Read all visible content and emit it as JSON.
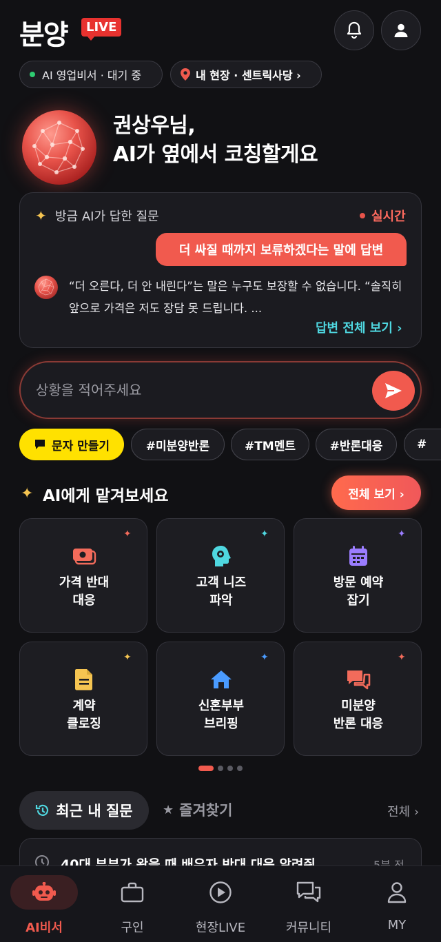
{
  "header": {
    "logo": "분양",
    "live_badge": "LIVE",
    "bell_icon": "bell-icon",
    "user_icon": "user-icon"
  },
  "status": {
    "ai_status": "AI 영업비서 · 대기 중",
    "site": "내 현장 · 센트릭사당 ›"
  },
  "hero": {
    "line1": "권상우님,",
    "line2": "AI가 옆에서 코칭할게요"
  },
  "qa_card": {
    "heading": "방금 AI가 답한 질문",
    "live_label": "실시간",
    "question": "더 싸질 때까지 보류하겠다는 말에 답변",
    "answer": "“더 오른다, 더 안 내린다”는 말은 누구도 보장할 수 없습니다. “솔직히 앞으로 가격은 저도 장담 못 드립니다. ...",
    "view_all": "답변 전체 보기 ›"
  },
  "composer": {
    "placeholder": "상황을 적어주세요",
    "send_icon": "send-icon"
  },
  "chips": [
    {
      "label": "문자 만들기"
    },
    {
      "label": "#미분양반론"
    },
    {
      "label": "#TM멘트"
    },
    {
      "label": "#반론대응"
    },
    {
      "label": "#"
    }
  ],
  "ai_section": {
    "title": "AI에게 맡겨보세요",
    "all_button": "전체 보기 ›",
    "tiles": [
      {
        "label": "가격 반대\n대응",
        "icon": "money-icon",
        "color": "#f26b5b"
      },
      {
        "label": "고객 니즈\n파악",
        "icon": "brain-gear-icon",
        "color": "#4fd7e0"
      },
      {
        "label": "방문 예약\n잡기",
        "icon": "calendar-icon",
        "color": "#9b7dff"
      },
      {
        "label": "계약\n클로징",
        "icon": "document-icon",
        "color": "#f5c451"
      },
      {
        "label": "신혼부부\n브리핑",
        "icon": "home-icon",
        "color": "#4a9bff"
      },
      {
        "label": "미분양\n반론 대응",
        "icon": "chat-bubbles-icon",
        "color": "#f26b5b"
      }
    ]
  },
  "recent": {
    "tab_recent": "최근 내 질문",
    "tab_favorites": "즐겨찾기",
    "all_link": "전체 ›",
    "item_text": "40대 부부가 왔을 때 배우자 반대 대응 알려줘",
    "item_time": "5분 전"
  },
  "bottom_nav": [
    {
      "label": "AI비서",
      "icon": "robot-icon",
      "active": true
    },
    {
      "label": "구인",
      "icon": "briefcase-icon",
      "active": false
    },
    {
      "label": "현장LIVE",
      "icon": "play-icon",
      "active": false
    },
    {
      "label": "커뮤니티",
      "icon": "chat-icon",
      "active": false
    },
    {
      "label": "MY",
      "icon": "person-icon",
      "active": false
    }
  ],
  "colors": {
    "accent": "#f15a4e",
    "background": "#111114",
    "sms_chip": "#ffe100",
    "link": "#4fd7e0"
  }
}
